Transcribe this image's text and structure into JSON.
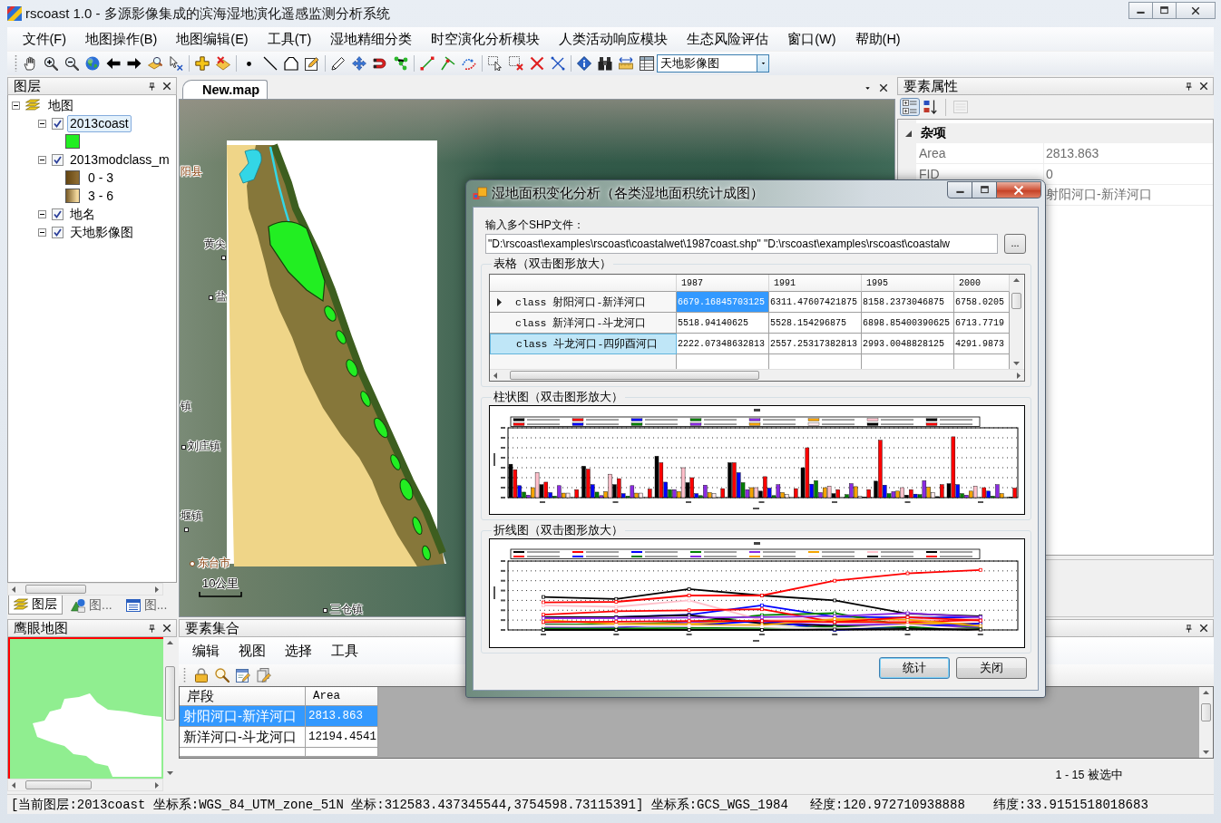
{
  "window": {
    "title": "rscoast 1.0 - 多源影像集成的滨海湿地演化遥感监测分析系统"
  },
  "menu": [
    "文件(F)",
    "地图操作(B)",
    "地图编辑(E)",
    "工具(T)",
    "湿地精细分类",
    "时空演化分析模块",
    "人类活动响应模块",
    "生态风险评估",
    "窗口(W)",
    "帮助(H)"
  ],
  "toolbar": {
    "basemap": "天地影像图"
  },
  "layers_panel": {
    "title": "图层",
    "tree": [
      {
        "label": "地图",
        "kind": "group",
        "expanded": true,
        "selected": false,
        "children": [
          {
            "label": "2013coast",
            "kind": "layer",
            "checked": true,
            "expanded": true,
            "selected": true,
            "children": [
              {
                "kind": "swatch",
                "color": "#22ee22",
                "selected": false
              }
            ]
          },
          {
            "label": "2013modclass_m",
            "kind": "layer",
            "checked": true,
            "expanded": true,
            "selected": false,
            "children": [
              {
                "kind": "ramp",
                "label": "0 - 3",
                "color": "#8c6a30",
                "selected": false
              },
              {
                "kind": "ramp",
                "label": "3 - 6",
                "color": "#f3d89c",
                "selected": false
              }
            ]
          },
          {
            "label": "地名",
            "kind": "layer",
            "checked": true,
            "expanded": true,
            "selected": false
          },
          {
            "label": "天地影像图",
            "kind": "layer",
            "checked": true,
            "expanded": true,
            "selected": false
          }
        ]
      }
    ],
    "tabs": [
      {
        "label": "图层",
        "selected": true
      },
      {
        "label": "图...",
        "selected": false
      },
      {
        "label": "图...",
        "selected": false
      }
    ]
  },
  "document": {
    "tab": {
      "label": "New.map",
      "selected": true
    },
    "map": {
      "labels": [
        {
          "text": "阳县",
          "kind": "seat"
        },
        {
          "text": "黄尖",
          "kind": "town"
        },
        {
          "text": "盐",
          "kind": "town"
        },
        {
          "text": "镇",
          "kind": "town"
        },
        {
          "text": "刘庄镇",
          "kind": "town"
        },
        {
          "text": "堰镇",
          "kind": "town"
        },
        {
          "text": "东台市",
          "kind": "city"
        },
        {
          "text": "三仓镇",
          "kind": "town"
        }
      ],
      "scale_bar": "10公里"
    }
  },
  "properties_panel": {
    "title": "要素属性",
    "view_buttons": [
      {
        "kind": "categorized",
        "selected": true,
        "disabled": false
      },
      {
        "kind": "alphabetical",
        "selected": false,
        "disabled": false
      },
      {
        "kind": "pages",
        "selected": false,
        "disabled": true
      }
    ],
    "category": {
      "label": "杂项",
      "expanded": true
    },
    "rows": [
      {
        "name": "Area",
        "value": "2813.863"
      },
      {
        "name": "FID",
        "value": "0"
      },
      {
        "value": "射阳河口-新洋河口"
      }
    ]
  },
  "overview_panel": {
    "title": "鹰眼地图"
  },
  "feature_panel": {
    "title": "要素集合",
    "menu": [
      "编辑",
      "视图",
      "选择",
      "工具"
    ],
    "table": {
      "columns": [
        "岸段",
        "Area"
      ],
      "rows": [
        {
          "cells": [
            "射阳河口-新洋河口",
            "2813.863"
          ],
          "selected": true
        },
        {
          "cells": [
            "新洋河口-斗龙河口",
            "12194.4541"
          ],
          "selected": false
        }
      ]
    },
    "selection": "1 - 15 被选中"
  },
  "status_bar": [
    "[当前图层:2013coast 坐标系:WGS_84_UTM_zone_51N 坐标:312583.437345544,3754598.73115391] 坐标系:GCS_WGS_1984",
    "经度:120.972710938888",
    "纬度:33.9151518018683"
  ],
  "dialog": {
    "title": "湿地面积变化分析（各类湿地面积统计成图）",
    "input": {
      "label": "输入多个SHP文件：",
      "value": "\"D:\\rscoast\\examples\\rscoast\\coastalwet\\1987coast.shp\" \"D:\\rscoast\\examples\\rscoast\\coastalw",
      "button": "..."
    },
    "table_group": "表格（双击图形放大）",
    "table": {
      "columns": [
        "1987",
        "1991",
        "1995",
        "2000"
      ],
      "rows": [
        {
          "header": "class 射阳河口-新洋河口",
          "current": true,
          "selected": false,
          "cells": [
            {
              "text": "6679.16845703125",
              "selected": true
            },
            {
              "text": "6311.47607421875",
              "selected": false
            },
            {
              "text": "8158.2373046875",
              "selected": false
            },
            {
              "text": "6758.0205",
              "selected": false
            }
          ]
        },
        {
          "header": "class 新洋河口-斗龙河口",
          "current": false,
          "selected": false,
          "cells": [
            {
              "text": "5518.94140625",
              "selected": false
            },
            {
              "text": "5528.154296875",
              "selected": false
            },
            {
              "text": "6898.85400390625",
              "selected": false
            },
            {
              "text": "6713.7719",
              "selected": false
            }
          ]
        },
        {
          "header": "class 斗龙河口-四卯酉河口",
          "current": false,
          "selected": true,
          "cells": [
            {
              "text": "2222.07348632813",
              "selected": false
            },
            {
              "text": "2557.25317382813",
              "selected": false
            },
            {
              "text": "2993.0048828125",
              "selected": false
            },
            {
              "text": "4291.9873",
              "selected": false
            }
          ]
        }
      ]
    },
    "bar_group": "柱状图（双击图形放大）",
    "line_group": "折线图（双击图形放大）",
    "buttons": [
      {
        "label": "统计",
        "default": true
      },
      {
        "label": "关闭",
        "default": false
      }
    ]
  }
}
